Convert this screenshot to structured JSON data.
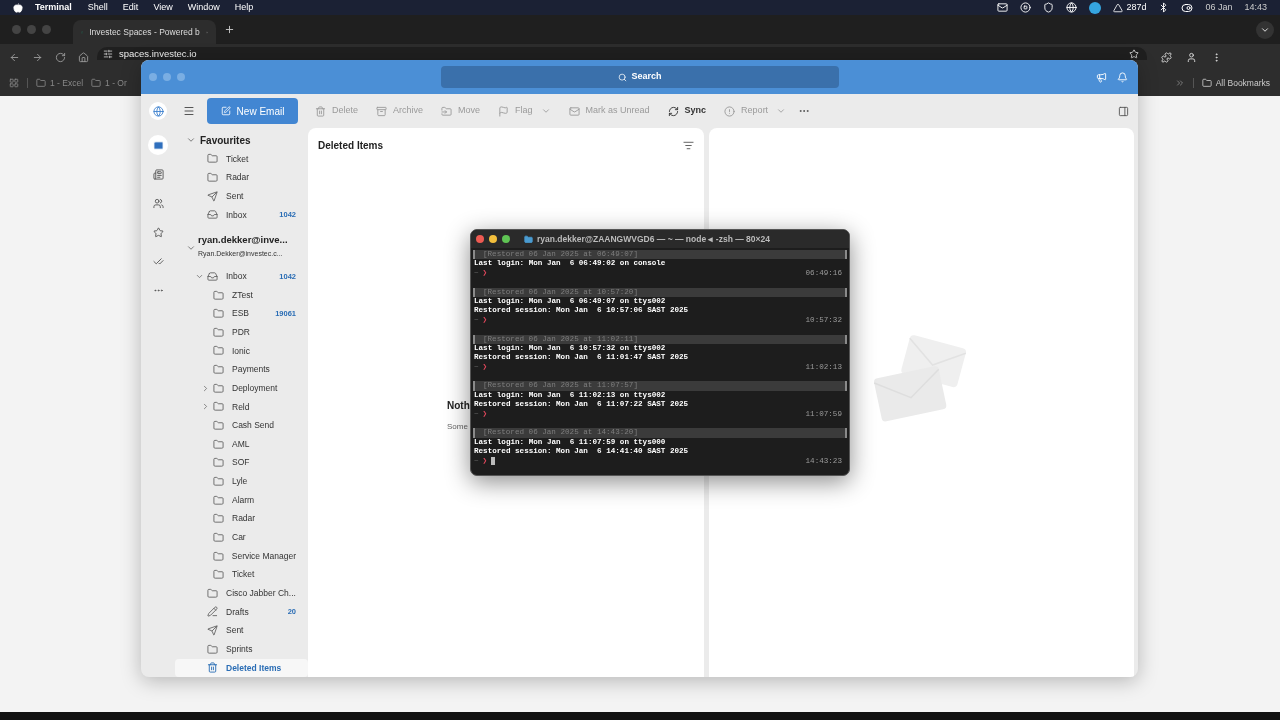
{
  "menu_bar": {
    "app": "Terminal",
    "menus": [
      "Shell",
      "Edit",
      "View",
      "Window",
      "Help"
    ],
    "status_text": "287d",
    "date": "06 Jan",
    "time": "14:43"
  },
  "browser": {
    "tab": {
      "title": "Investec Spaces - Powered b",
      "selected": true
    },
    "url": "spaces.investec.io",
    "bookmarks": [
      "1 - Excel",
      "1 - Or"
    ],
    "all_bookmarks": "All Bookmarks"
  },
  "outlook": {
    "search": {
      "placeholder": "Search"
    },
    "nav_rail": [
      {
        "kind": "mail",
        "selected": true
      },
      {
        "kind": "notes",
        "selected": false
      },
      {
        "kind": "people",
        "selected": false
      },
      {
        "kind": "favorites",
        "selected": false
      },
      {
        "kind": "tasks",
        "selected": false
      },
      {
        "kind": "more",
        "selected": false
      }
    ],
    "toolbar": {
      "new_email": "New Email",
      "actions": [
        {
          "kind": "delete",
          "label": "Delete",
          "disabled": true,
          "dropdown": false
        },
        {
          "kind": "archive",
          "label": "Archive",
          "disabled": true,
          "dropdown": false
        },
        {
          "kind": "move",
          "label": "Move",
          "disabled": true,
          "dropdown": false
        },
        {
          "kind": "flag",
          "label": "Flag",
          "disabled": true,
          "dropdown": true
        },
        {
          "kind": "unread",
          "label": "Mark as Unread",
          "disabled": true,
          "dropdown": false
        },
        {
          "kind": "sync",
          "label": "Sync",
          "disabled": false,
          "dropdown": false
        },
        {
          "kind": "report",
          "label": "Report",
          "disabled": true,
          "dropdown": true
        }
      ]
    },
    "favourites": {
      "title": "Favourites",
      "expanded": true,
      "items": [
        {
          "label": "Ticket",
          "kind": "folder",
          "selected": false
        },
        {
          "label": "Radar",
          "kind": "folder",
          "selected": false
        },
        {
          "label": "Sent",
          "kind": "sent",
          "selected": false
        },
        {
          "label": "Inbox",
          "kind": "inbox",
          "count": "1042",
          "selected": false
        }
      ]
    },
    "account": {
      "name": "ryan.dekker@inve...",
      "email": "Ryan.Dekker@investec.c...",
      "expanded": true,
      "folders": [
        {
          "label": "Inbox",
          "kind": "inbox",
          "count": "1042",
          "selected": false,
          "expanded": true,
          "children": [
            {
              "label": "ZTest",
              "kind": "folder",
              "selected": false
            },
            {
              "label": "ESB",
              "kind": "folder",
              "count": "19061",
              "selected": false
            },
            {
              "label": "PDR",
              "kind": "folder",
              "selected": false
            },
            {
              "label": "Ionic",
              "kind": "folder",
              "selected": false
            },
            {
              "label": "Payments",
              "kind": "folder",
              "selected": false
            },
            {
              "label": "Deployment",
              "kind": "folder",
              "selected": false,
              "expanded": false
            },
            {
              "label": "Reld",
              "kind": "folder",
              "selected": false,
              "expanded": false
            },
            {
              "label": "Cash Send",
              "kind": "folder",
              "selected": false
            },
            {
              "label": "AML",
              "kind": "folder",
              "selected": false
            },
            {
              "label": "SOF",
              "kind": "folder",
              "selected": false
            },
            {
              "label": "Lyle",
              "kind": "folder",
              "selected": false
            },
            {
              "label": "Alarm",
              "kind": "folder",
              "selected": false
            },
            {
              "label": "Radar",
              "kind": "folder",
              "selected": false
            },
            {
              "label": "Car",
              "kind": "folder",
              "selected": false
            },
            {
              "label": "Service Manager",
              "kind": "folder",
              "selected": false
            },
            {
              "label": "Ticket",
              "kind": "folder",
              "selected": false
            }
          ]
        },
        {
          "label": "Cisco Jabber Ch...",
          "kind": "folder",
          "selected": false
        },
        {
          "label": "Drafts",
          "kind": "drafts",
          "count": "20",
          "selected": false
        },
        {
          "label": "Sent",
          "kind": "sent",
          "selected": false
        },
        {
          "label": "Sprints",
          "kind": "folder",
          "selected": false
        },
        {
          "label": "Deleted Items",
          "kind": "trash",
          "selected": true
        }
      ]
    },
    "list_pane": {
      "title": "Deleted Items",
      "empty_title": "Noth",
      "empty_text": "Some"
    }
  },
  "terminal": {
    "title": "ryan.dekker@ZAANGWVGD6 — ~ — node ◂ -zsh — 80×24",
    "sessions": [
      {
        "restored": "[Restored 06 Jan 2025 at 06:49:07]",
        "lines": [
          "Last login: Mon Jan  6 06:49:02 on console"
        ],
        "prompt_dir": "~",
        "prompt": "❯",
        "time": "06:49:16"
      },
      {
        "restored": "[Restored 06 Jan 2025 at 10:57:20]",
        "lines": [
          "Last login: Mon Jan  6 06:49:07 on ttys002",
          "Restored session: Mon Jan  6 10:57:06 SAST 2025"
        ],
        "prompt_dir": "~",
        "prompt": "❯",
        "time": "10:57:32"
      },
      {
        "restored": "[Restored 06 Jan 2025 at 11:02:11]",
        "lines": [
          "Last login: Mon Jan  6 10:57:32 on ttys002",
          "Restored session: Mon Jan  6 11:01:47 SAST 2025"
        ],
        "prompt_dir": "~",
        "prompt": "❯",
        "time": "11:02:13"
      },
      {
        "restored": "[Restored 06 Jan 2025 at 11:07:57]",
        "lines": [
          "Last login: Mon Jan  6 11:02:13 on ttys002",
          "Restored session: Mon Jan  6 11:07:22 SAST 2025"
        ],
        "prompt_dir": "~",
        "prompt": "❯",
        "time": "11:07:59"
      },
      {
        "restored": "[Restored 06 Jan 2025 at 14:43:20]",
        "lines": [
          "Last login: Mon Jan  6 11:07:59 on ttys000",
          "Restored session: Mon Jan  6 14:41:40 SAST 2025"
        ],
        "prompt_dir": "~",
        "prompt": "❯",
        "time": "14:43:23",
        "cursor": true
      }
    ]
  }
}
